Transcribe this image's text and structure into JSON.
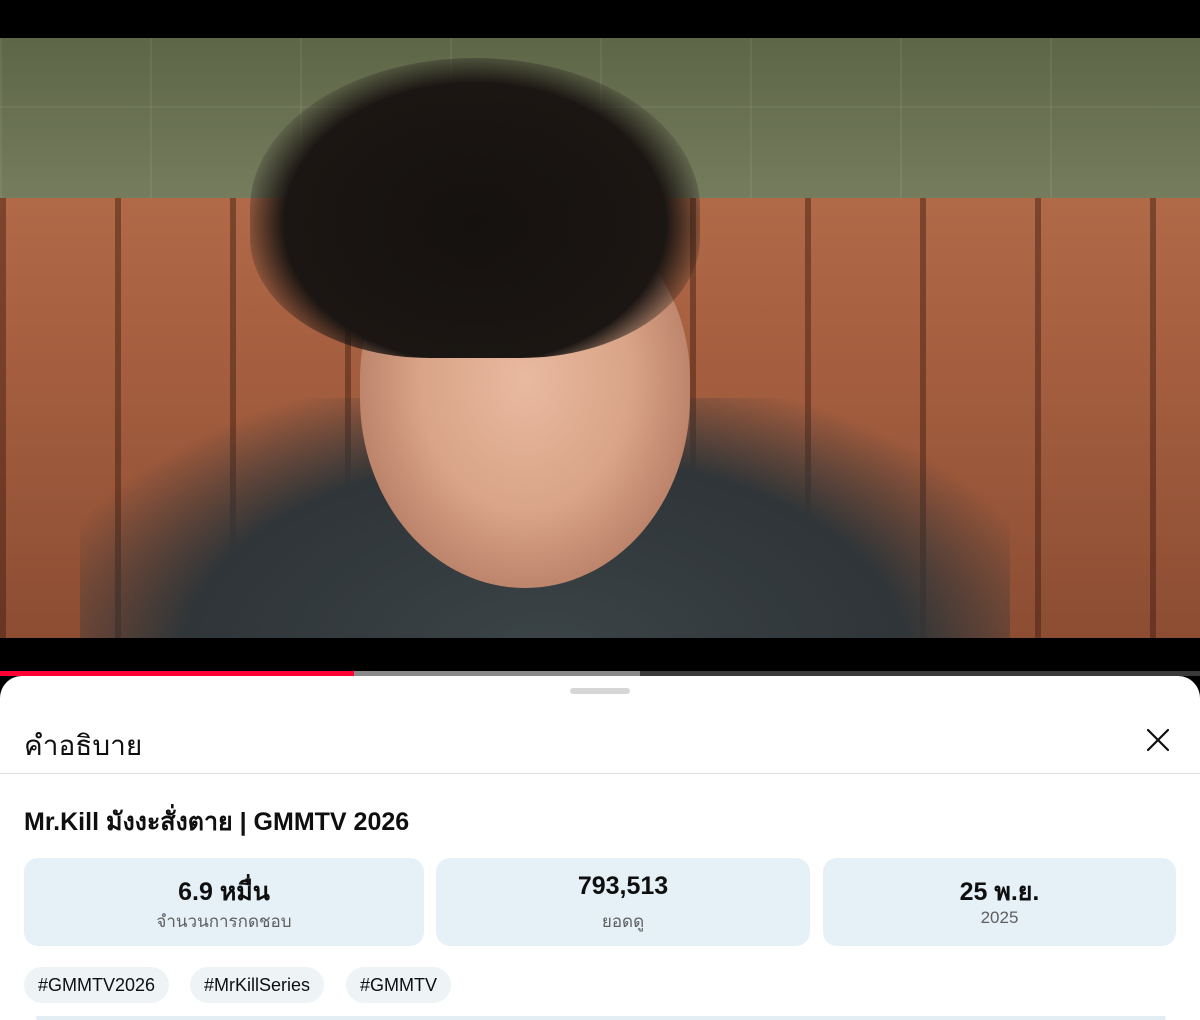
{
  "player": {
    "progress_played": 0.295,
    "progress_buffered": 0.533,
    "colors": {
      "played": "#ff0033",
      "buffered": "#8a8a8a",
      "track": "#3a3a3a"
    }
  },
  "sheet": {
    "title": "คำอธิบาย",
    "close_icon": "close-icon"
  },
  "video": {
    "title": "Mr.Kill มังงะสั่งตาย | GMMTV 2026"
  },
  "stats": [
    {
      "value": "6.9 หมื่น",
      "label": "จำนวนการกดชอบ"
    },
    {
      "value": "793,513",
      "label": "ยอดดู"
    },
    {
      "value": "25 พ.ย.",
      "label": "2025"
    }
  ],
  "tags": [
    "#GMMTV2026",
    "#MrKillSeries",
    "#GMMTV"
  ],
  "colors": {
    "stat_bg": "#e5f1f7",
    "tag_bg": "#eef3f6"
  }
}
